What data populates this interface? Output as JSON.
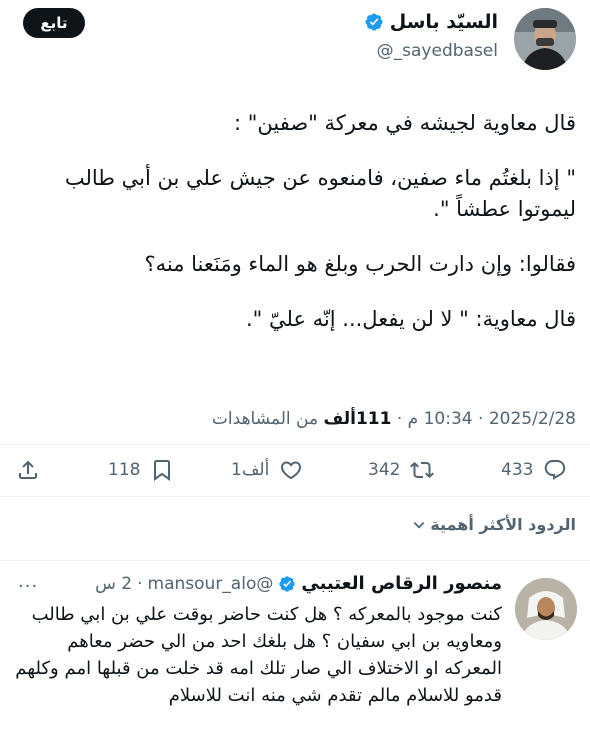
{
  "header": {
    "follow_label": "تابع",
    "author_name": "السيّد باسل",
    "author_handle": "@_sayedbasel"
  },
  "tweet": {
    "lines": [
      "قال معاوية لجيشه في معركة \"صفين\" :",
      "\" إذا بلغتُم ماء صفين، فامنعوه عن جيش علي بن أبي طالب",
      "ليموتوا عطشاً \".",
      "فقالوا:  وإن دارت الحرب وبلغ هو الماء ومَنَعنا منه؟",
      "قال معاوية: \" لا لن يفعل... إنّه عليّ \"."
    ],
    "date": "2025/2/28",
    "time": "10:34 م",
    "views_count": "111ألف",
    "views_label": "من المشاهدات",
    "separator": "·"
  },
  "actions": {
    "replies": "433",
    "reposts": "342",
    "likes": "1ألف",
    "bookmarks": "118"
  },
  "sort": {
    "label": "الردود الأكثر أهمية"
  },
  "reply": {
    "name": "منصور الرقاص العتيبي",
    "handle": "@mansour_alo",
    "time": "2 س",
    "separator": "·",
    "menu": "···",
    "text": "كنت موجود بالمعركه ؟ هل كنت حاضر بوقت علي بن ابي طالب ومعاويه بن ابي سفيان ؟ هل بلغك احد من الي حضر معاهم المعركه او الاختلاف الي صار تلك امه قد خلت من قبلها امم وكلهم قدمو للاسلام مالم تقدم شي منه انت للاسلام"
  },
  "colors": {
    "text": "#0f1419",
    "secondary": "#536471",
    "verified": "#1d9bf0",
    "divider": "#eff3f4"
  }
}
